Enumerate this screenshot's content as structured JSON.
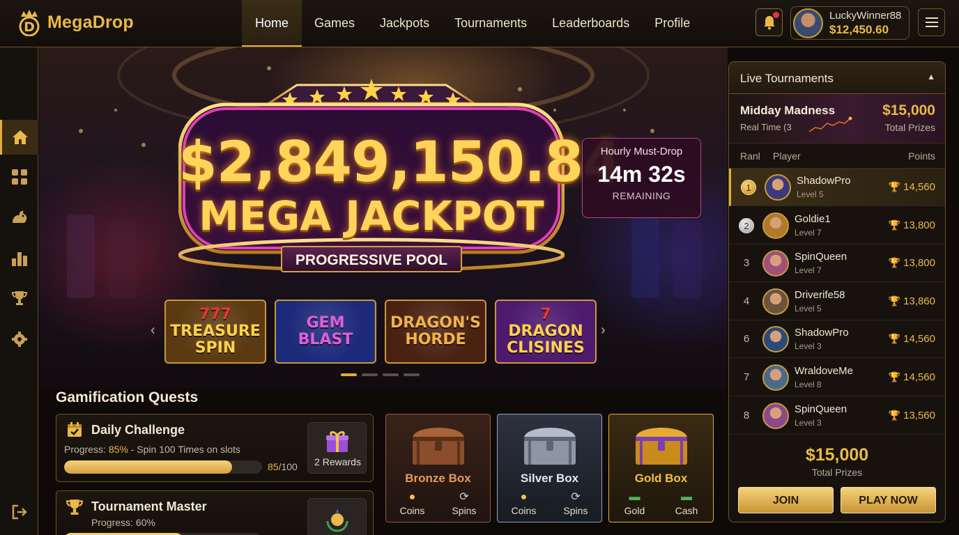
{
  "brand": {
    "name": "MegaDrop",
    "logo_letter": "D"
  },
  "nav": [
    {
      "label": "Home",
      "active": true
    },
    {
      "label": "Games",
      "active": false
    },
    {
      "label": "Jackpots",
      "active": false
    },
    {
      "label": "Tournaments",
      "active": false
    },
    {
      "label": "Leaderboards",
      "active": false
    },
    {
      "label": "Profile",
      "active": false
    }
  ],
  "header": {
    "notification_icon": "bell-icon",
    "user": {
      "name": "LuckyWinner88",
      "balance": "$12,450.60"
    },
    "menu_icon": "hamburger-icon"
  },
  "sidebar": [
    {
      "icon": "home-icon",
      "active": true
    },
    {
      "icon": "grid-icon",
      "active": false
    },
    {
      "icon": "dragon-icon",
      "active": false
    },
    {
      "icon": "leaderboard-icon",
      "active": false
    },
    {
      "icon": "trophy-icon",
      "active": false
    },
    {
      "icon": "settings-icon",
      "active": false
    },
    {
      "icon": "logout-icon",
      "active": false
    }
  ],
  "hero": {
    "jackpot_amount": "$2,849,150.84",
    "jackpot_title": "MEGA JACKPOT",
    "jackpot_pool": "PROGRESSIVE POOL",
    "must_drop": {
      "label": "Hourly Must-Drop",
      "time": "14m 32s",
      "remaining": "REMAINING"
    },
    "games": [
      {
        "line1": "777",
        "line2": "TREASURE",
        "line3": "SPIN",
        "bg": "#5b3a12"
      },
      {
        "line1": "GEM",
        "line2": "BLAST",
        "line3": "",
        "bg": "#1d2a7a"
      },
      {
        "line1": "DRAGON'S",
        "line2": "HORDE",
        "line3": "",
        "bg": "#4a2212"
      },
      {
        "line1": "7",
        "line2": "DRAGON",
        "line3": "CLISINES",
        "bg": "#4d1a6e"
      }
    ],
    "carousel_dots": 4,
    "carousel_active": 0
  },
  "quests": {
    "title": "Gamification Quests",
    "items": [
      {
        "title": "Daily Challenge",
        "progress_label": "Progress:",
        "progress_pct": "85%",
        "progress_note": "- Spin 100 Times on slots",
        "progress_value": 0.85,
        "count_current": "85",
        "count_total": "/100",
        "reward": "2 Rewards",
        "icon": "calendar-check-icon"
      },
      {
        "title": "Tournament Master",
        "progress_label": "Progress:",
        "progress_pct": "60%",
        "progress_note": "",
        "progress_value": 0.6,
        "icon": "trophy-icon"
      }
    ]
  },
  "chests": [
    {
      "name": "Bronze Box",
      "color": "#e39b5a",
      "options": [
        {
          "label": "Coins",
          "icon": "coins-icon"
        },
        {
          "label": "Spins",
          "icon": "refresh-icon"
        }
      ]
    },
    {
      "name": "Silver Box",
      "color": "#e6e8ee",
      "options": [
        {
          "label": "Coins",
          "icon": "coins-icon"
        },
        {
          "label": "Spins",
          "icon": "refresh-icon"
        }
      ]
    },
    {
      "name": "Gold Box",
      "color": "#f3c143",
      "options": [
        {
          "label": "Gold",
          "icon": "cash-icon"
        },
        {
          "label": "Cash",
          "icon": "cash-icon"
        }
      ]
    }
  ],
  "panel": {
    "title": "Live Tournaments",
    "tournament": {
      "name": "Midday Madness",
      "subtitle": "Real Time (3",
      "prize": "$15,000",
      "prize_label": "Total Prizes"
    },
    "columns": {
      "rank": "Ranl",
      "player": "Player",
      "points": "Points"
    },
    "rows": [
      {
        "rank": "1",
        "name": "ShadowPro",
        "level": "Level 5",
        "points": "14,560",
        "avatar": "#3a3a7a"
      },
      {
        "rank": "2",
        "name": "Goldie1",
        "level": "Level 7",
        "points": "13,800",
        "avatar": "#b07a2a"
      },
      {
        "rank": "3",
        "name": "SpinQueen",
        "level": "Level 7",
        "points": "13,800",
        "avatar": "#a0507a"
      },
      {
        "rank": "4",
        "name": "Driverife58",
        "level": "Level 5",
        "points": "13,860",
        "avatar": "#6a5440"
      },
      {
        "rank": "6",
        "name": "ShadowPro",
        "level": "Level 3",
        "points": "14,560",
        "avatar": "#2a4a7a"
      },
      {
        "rank": "7",
        "name": "WraldoveMe",
        "level": "Level 8",
        "points": "14,560",
        "avatar": "#4a6a8a"
      },
      {
        "rank": "8",
        "name": "SpinQueen",
        "level": "Level 3",
        "points": "13,560",
        "avatar": "#8a4a8a"
      }
    ],
    "total_amount": "$15,000",
    "total_label": "Total Prizes",
    "join_label": "JOIN",
    "play_label": "PLAY NOW"
  }
}
